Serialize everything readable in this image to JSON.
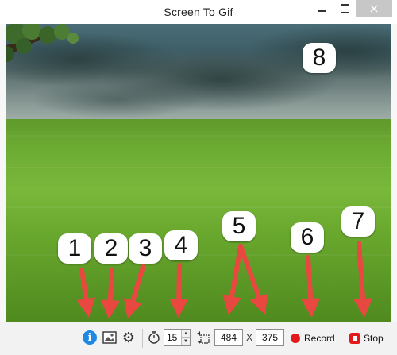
{
  "window": {
    "title": "Screen To Gif"
  },
  "toolbar": {
    "frame_rate": "15",
    "width": "484",
    "height": "375",
    "x_separator": "X",
    "record_label": "Record",
    "stop_label": "Stop"
  },
  "annotations": [
    "1",
    "2",
    "3",
    "4",
    "5",
    "6",
    "7",
    "8"
  ],
  "icons": {
    "info": "info-icon",
    "image": "image-icon",
    "settings": "gear-icon",
    "timer": "stopwatch-icon",
    "size": "resize-icon",
    "record": "record-dot-icon",
    "stop": "stop-icon"
  },
  "colors": {
    "arrow": "#e8483f",
    "record": "#e3191c",
    "info": "#1e88e5"
  }
}
